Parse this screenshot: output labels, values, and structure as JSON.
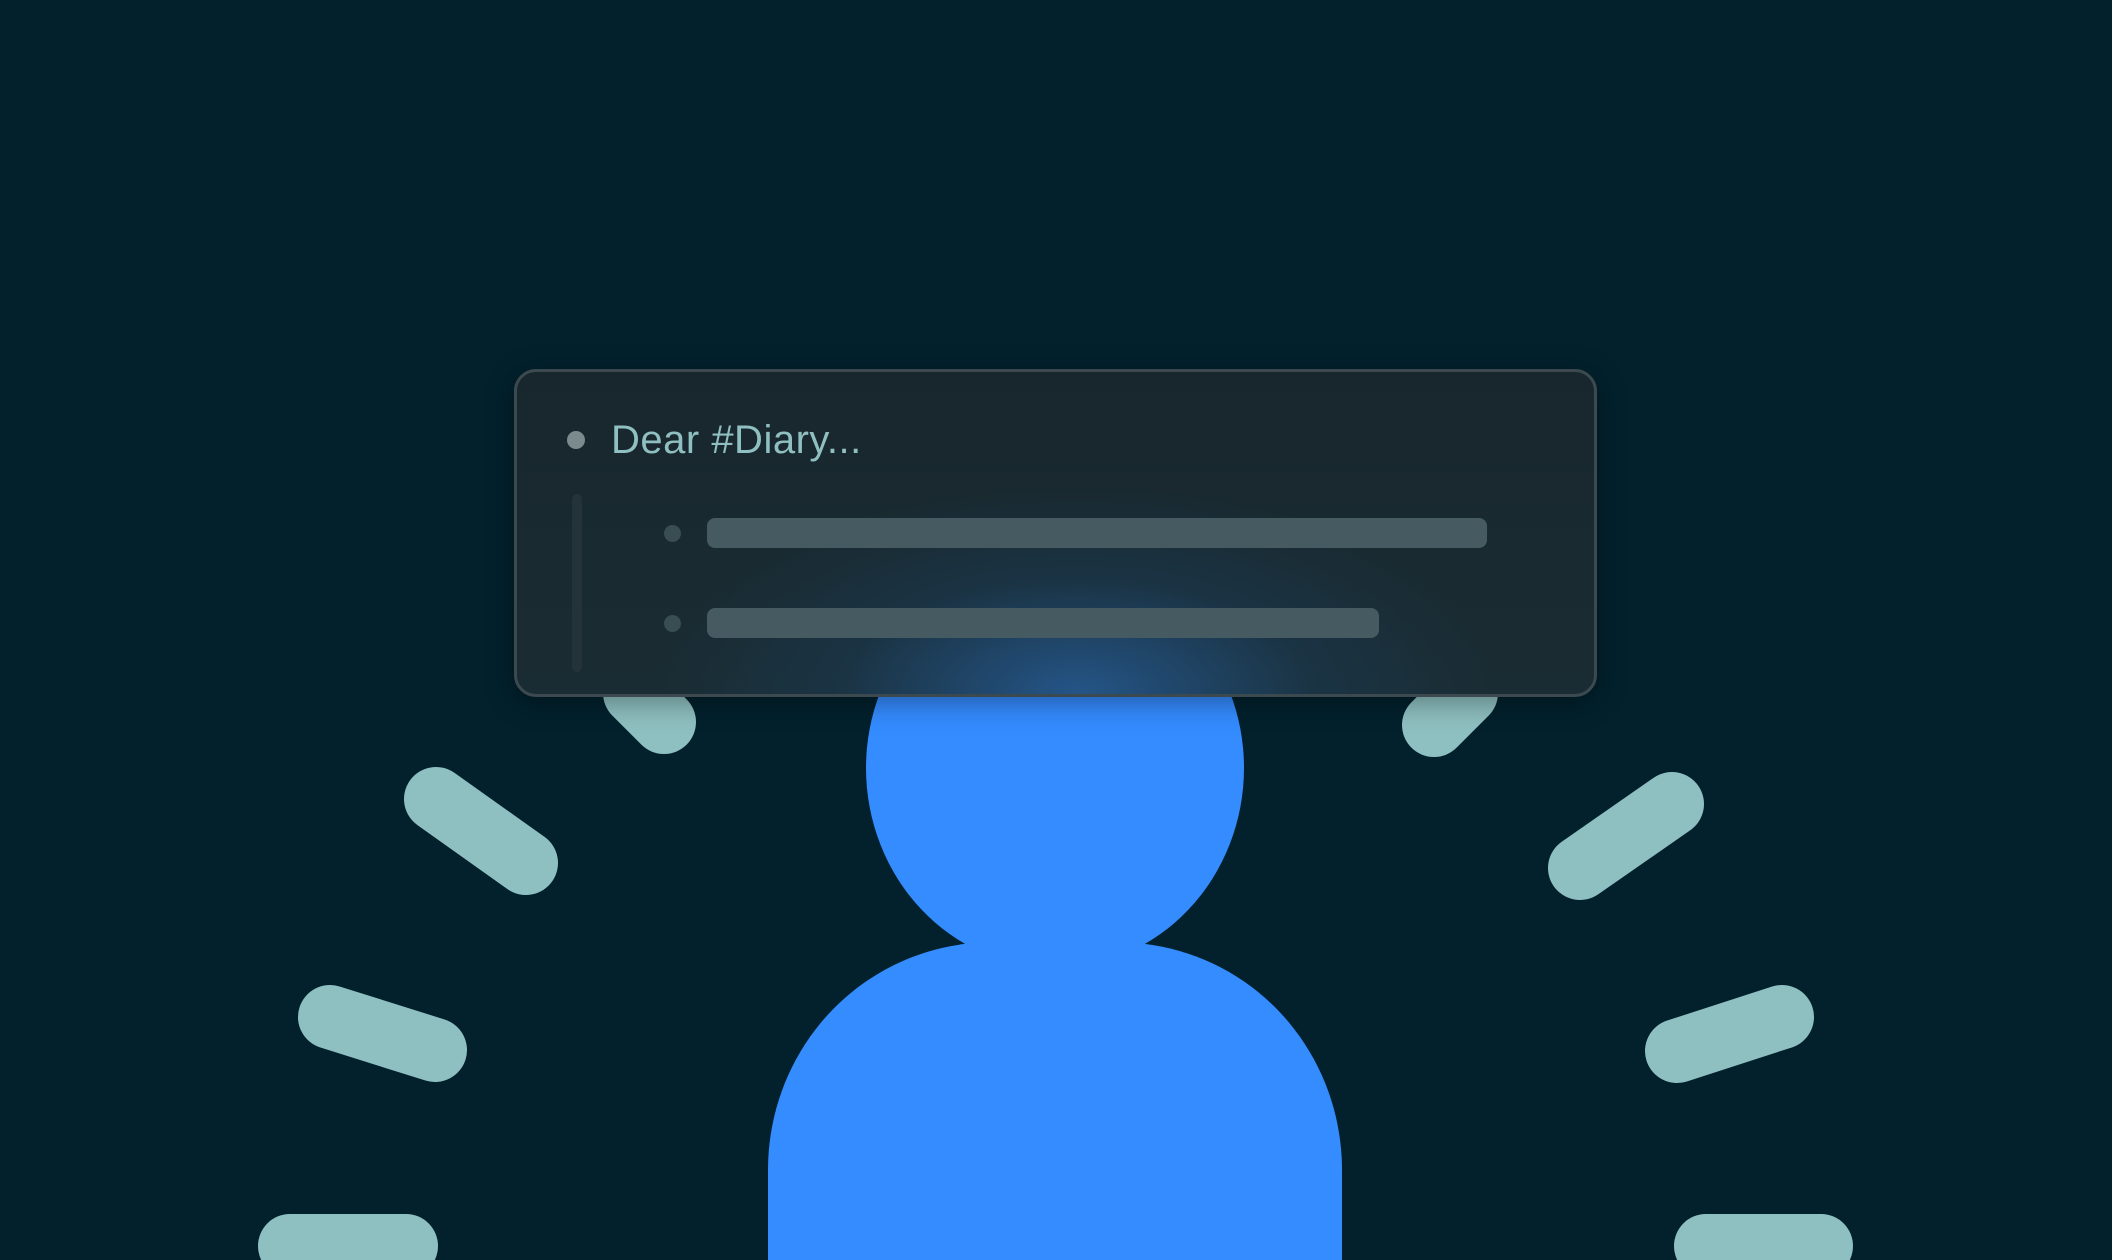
{
  "card": {
    "title": "Dear #Diary..."
  },
  "colors": {
    "background": "#02212d",
    "figure": "#348cff",
    "rays": "#8fc0c1",
    "title_text": "#8fbfc1",
    "placeholder_bar": "#465a61"
  },
  "icons": {
    "person": "person-silhouette-icon",
    "rays": "ray-marks",
    "bullets": "bullet-dot-icon"
  }
}
